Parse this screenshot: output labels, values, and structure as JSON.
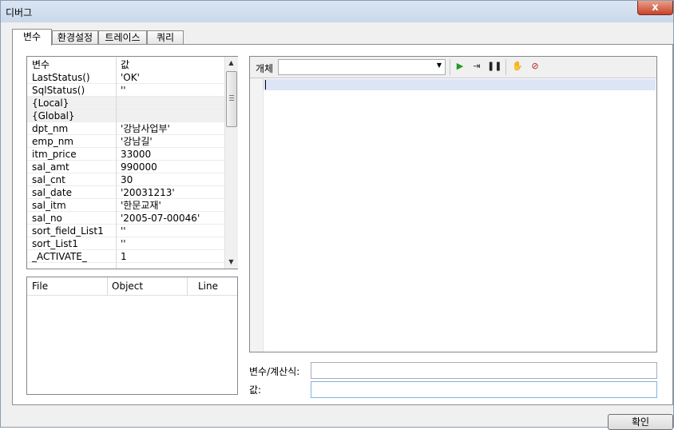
{
  "window": {
    "title": "디버그",
    "close_label": "x"
  },
  "tabs": [
    "변수",
    "환경설정",
    "트레이스",
    "쿼리"
  ],
  "variables": {
    "headers": {
      "name": "변수",
      "value": "값"
    },
    "rows": [
      {
        "name": "LastStatus()",
        "value": "'OK'"
      },
      {
        "name": "SqlStatus()",
        "value": "''"
      },
      {
        "name": "{Local}",
        "value": ""
      },
      {
        "name": "{Global}",
        "value": ""
      },
      {
        "name": "dpt_nm",
        "value": "'강남사업부'"
      },
      {
        "name": "emp_nm",
        "value": "'강남길'"
      },
      {
        "name": "itm_price",
        "value": "33000"
      },
      {
        "name": "sal_amt",
        "value": "990000"
      },
      {
        "name": "sal_cnt",
        "value": "30"
      },
      {
        "name": "sal_date",
        "value": "'20031213'"
      },
      {
        "name": "sal_itm",
        "value": "'한문교재'"
      },
      {
        "name": "sal_no",
        "value": "'2005-07-00046'"
      },
      {
        "name": "sort_field_List1",
        "value": "''"
      },
      {
        "name": "sort_List1",
        "value": "''"
      },
      {
        "name": "_ACTIVATE_",
        "value": "1"
      }
    ]
  },
  "call_stack": {
    "headers": {
      "file": "File",
      "object": "Object",
      "line": "Line"
    }
  },
  "editor": {
    "object_label": "개체",
    "object_value": ""
  },
  "expression": {
    "label": "변수/계산식:",
    "value": ""
  },
  "value_field": {
    "label": "값:",
    "value": ""
  },
  "ok_button": "확인",
  "colors": {
    "current_line": "#dde4f6",
    "titlebar": "#c9d8ea",
    "close": "#c7432c"
  },
  "icons": [
    "run-icon",
    "step-icon",
    "pause-icon",
    "hand-icon",
    "breakpoint-clear-icon",
    "dropdown-arrow-icon"
  ]
}
